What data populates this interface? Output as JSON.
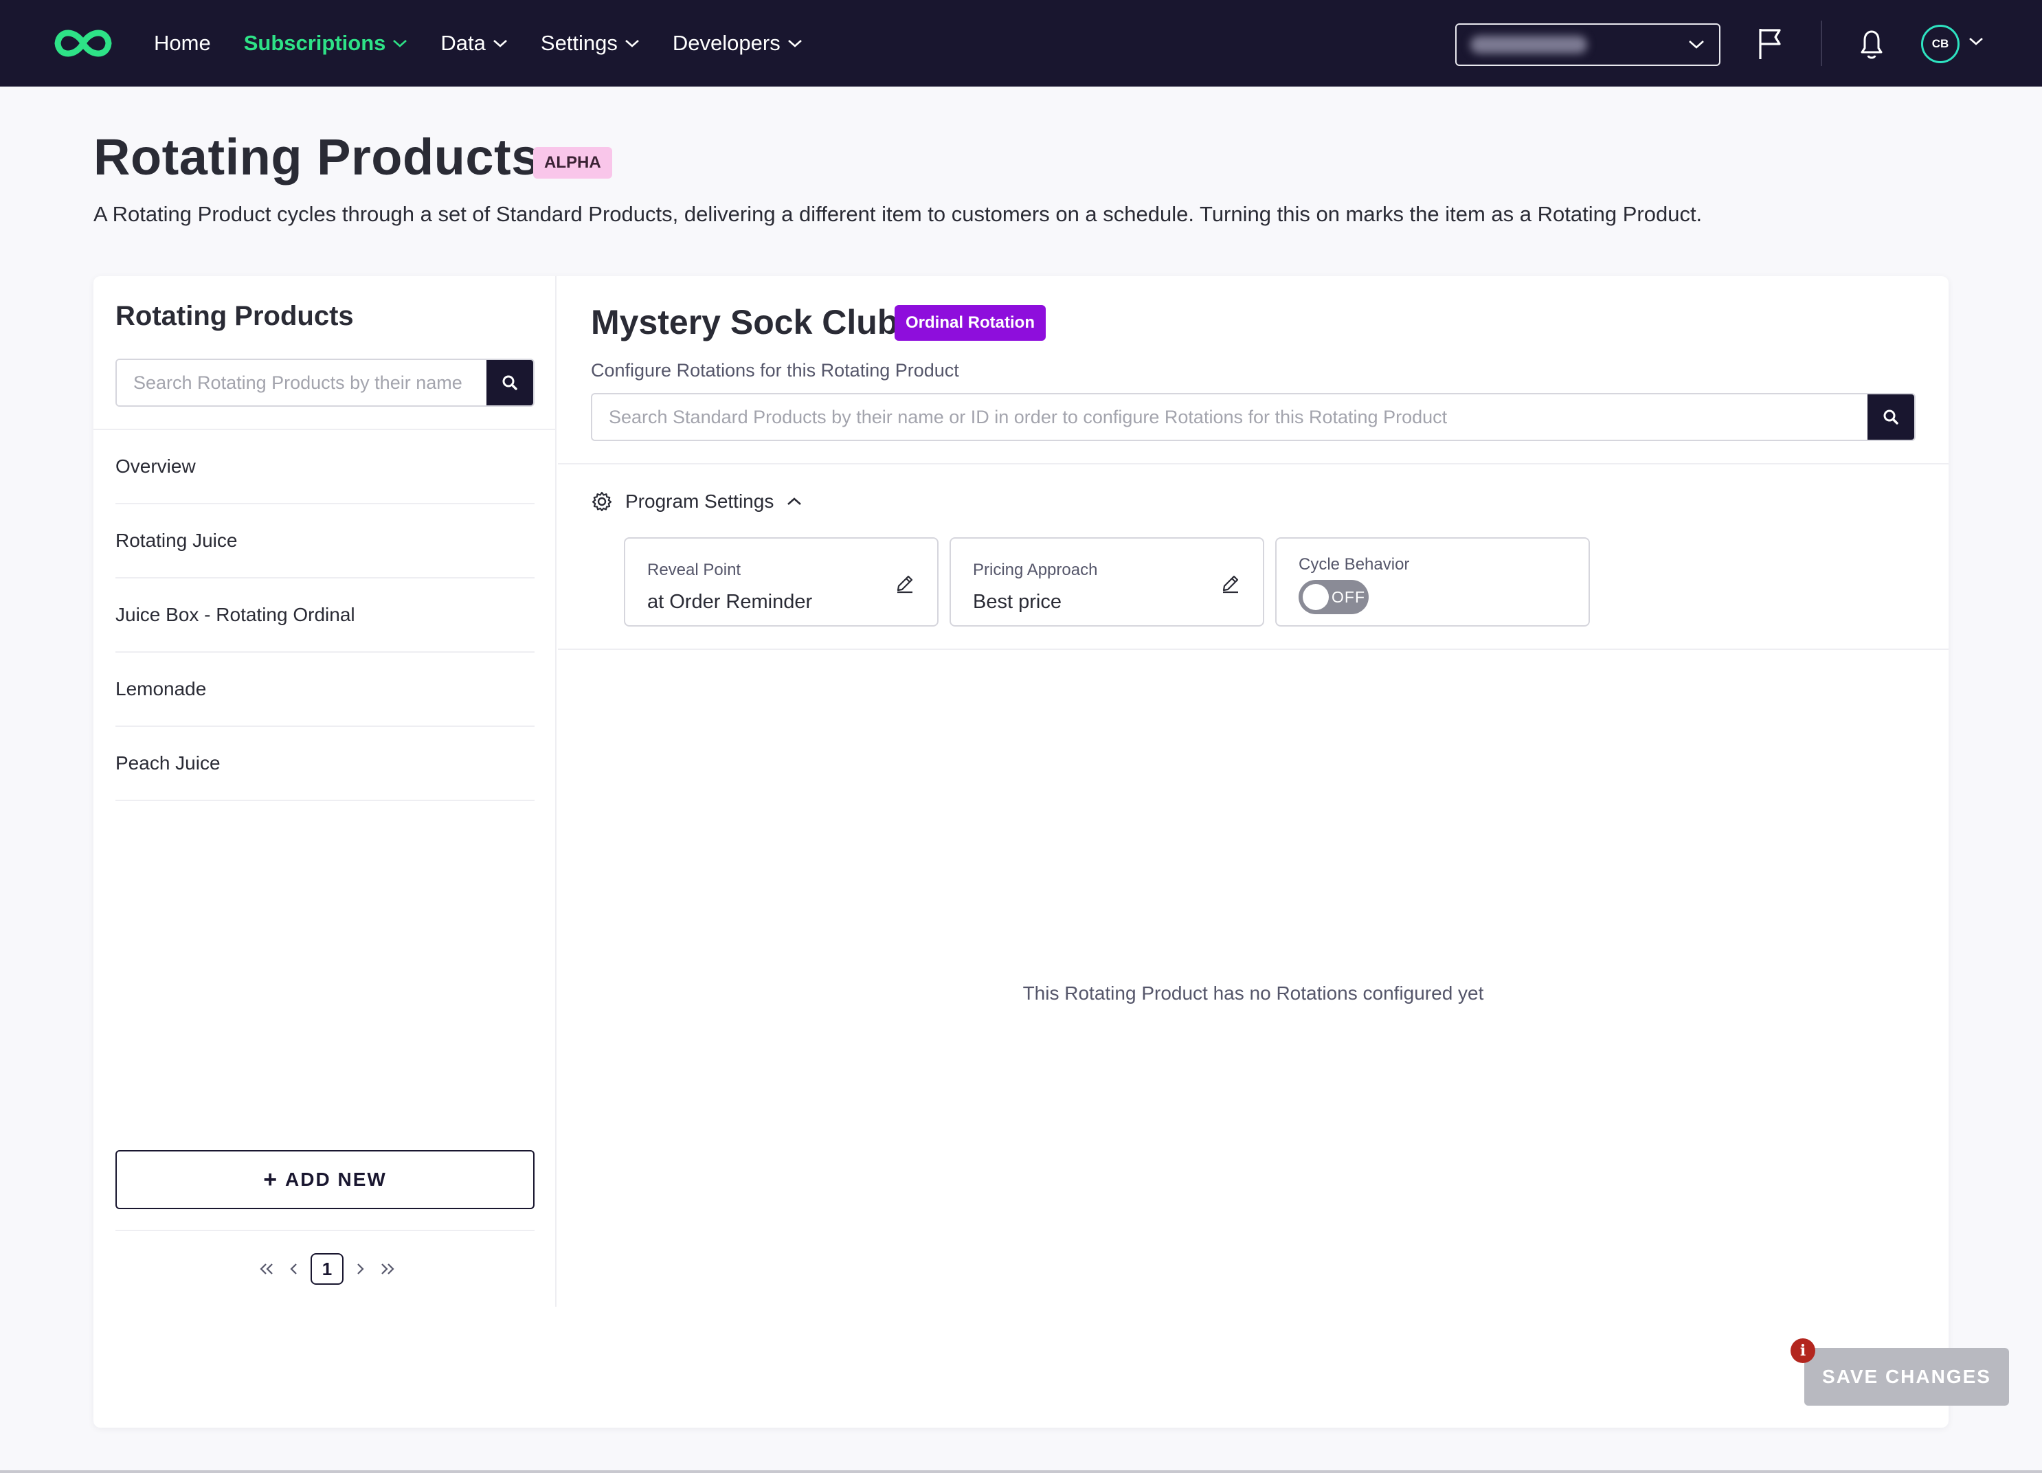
{
  "nav": {
    "logo_icon": "infinity-logo-icon",
    "items": [
      {
        "label": "Home",
        "active": false,
        "dropdown": false
      },
      {
        "label": "Subscriptions",
        "active": true,
        "dropdown": true
      },
      {
        "label": "Data",
        "active": false,
        "dropdown": true
      },
      {
        "label": "Settings",
        "active": false,
        "dropdown": true
      },
      {
        "label": "Developers",
        "active": false,
        "dropdown": true
      }
    ],
    "avatar_initials": "CB",
    "accent_color": "#2ee287",
    "background_color": "#19162f"
  },
  "page": {
    "title": "Rotating Products",
    "badge": "ALPHA",
    "description": "A Rotating Product cycles through a set of Standard Products, delivering a different item to customers on a schedule. Turning this on marks the item as a Rotating Product."
  },
  "sidebar": {
    "title": "Rotating Products",
    "search_placeholder": "Search Rotating Products by their name",
    "items": [
      {
        "label": "Overview"
      },
      {
        "label": "Rotating Juice"
      },
      {
        "label": "Juice Box - Rotating Ordinal"
      },
      {
        "label": "Lemonade"
      },
      {
        "label": "Peach Juice"
      }
    ],
    "add_new_label": "ADD NEW",
    "current_page": "1"
  },
  "main": {
    "title": "Mystery Sock Club",
    "badge": "Ordinal Rotation",
    "badge_color": "#8e0edc",
    "config_label": "Configure Rotations for this Rotating Product",
    "search_placeholder": "Search Standard Products by their name or ID in order to configure Rotations for this Rotating Product",
    "program_settings_label": "Program Settings",
    "settings": {
      "reveal_point": {
        "label": "Reveal Point",
        "value": "at Order Reminder"
      },
      "pricing_approach": {
        "label": "Pricing Approach",
        "value": "Best price"
      },
      "cycle_behavior": {
        "label": "Cycle Behavior",
        "toggle": "OFF"
      }
    },
    "empty_message": "This Rotating Product has no Rotations configured yet",
    "save_label": "SAVE CHANGES",
    "save_info_icon": "i"
  }
}
